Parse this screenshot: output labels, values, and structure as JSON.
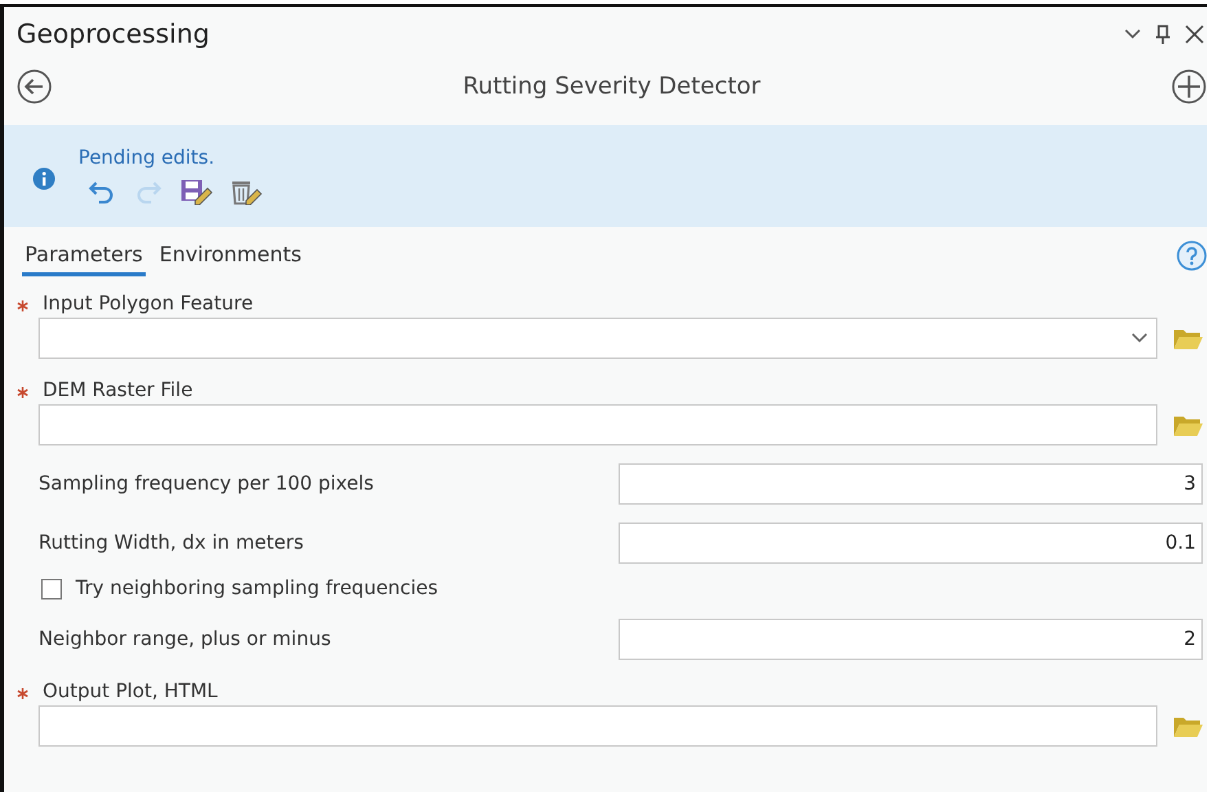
{
  "pane": {
    "title": "Geoprocessing"
  },
  "tool": {
    "title": "Rutting Severity Detector"
  },
  "message": {
    "text": "Pending edits."
  },
  "edit_tools": [
    {
      "kind": "undo",
      "disabled": false
    },
    {
      "kind": "redo",
      "disabled": true
    },
    {
      "kind": "save",
      "disabled": false
    },
    {
      "kind": "discard",
      "disabled": false
    }
  ],
  "tabs": [
    {
      "label": "Parameters",
      "selected": true
    },
    {
      "label": "Environments",
      "selected": false
    }
  ],
  "params": [
    {
      "kind": "path",
      "label": "Input Polygon Feature",
      "required": true,
      "dropdown": true
    },
    {
      "kind": "path",
      "label": "DEM Raster File",
      "required": true,
      "dropdown": false
    },
    {
      "kind": "number",
      "label": "Sampling frequency per 100 pixels",
      "value": "3"
    },
    {
      "kind": "number",
      "label": "Rutting Width, dx in meters",
      "value": "0.1"
    },
    {
      "kind": "checkbox",
      "label": "Try neighboring sampling frequencies",
      "checked": false
    },
    {
      "kind": "number",
      "label": "Neighbor range, plus or minus",
      "value": "2"
    },
    {
      "kind": "path",
      "label": "Output Plot, HTML",
      "required": true,
      "dropdown": false
    }
  ]
}
